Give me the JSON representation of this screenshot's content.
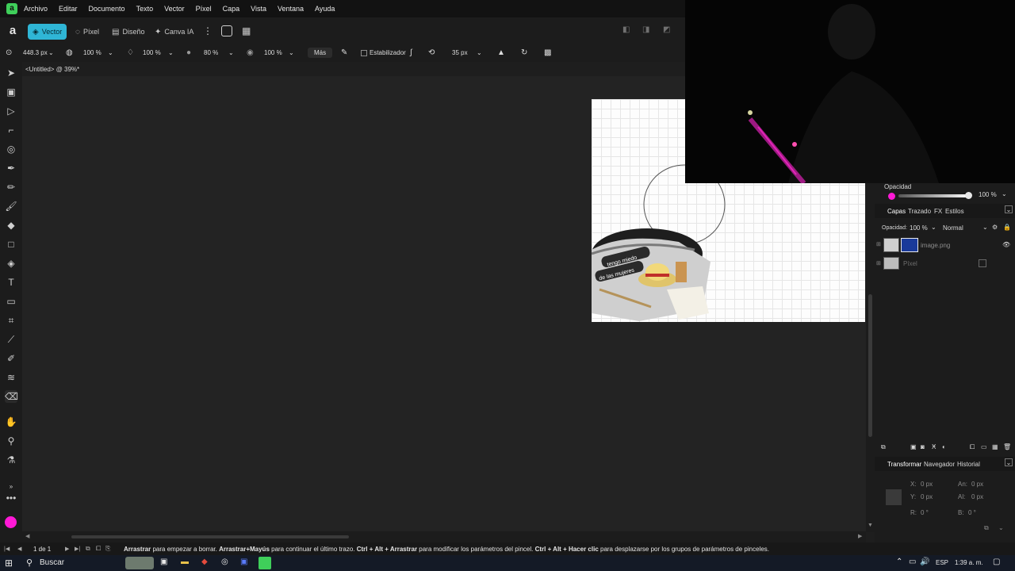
{
  "app": {
    "logo_letter": "a",
    "menu": [
      "Archivo",
      "Editar",
      "Documento",
      "Texto",
      "Vector",
      "Píxel",
      "Capa",
      "Vista",
      "Ventana",
      "Ayuda"
    ]
  },
  "toolbar": {
    "personas": [
      {
        "label": "Vector",
        "active": true
      },
      {
        "label": "Píxel",
        "active": false
      },
      {
        "label": "Diseño",
        "active": false
      },
      {
        "label": "Canva IA",
        "active": false
      }
    ]
  },
  "context": {
    "width": "448.3 px",
    "opacity1": "100 %",
    "flow": "100 %",
    "hardness": "80 %",
    "opacity2": "100 %",
    "more_label": "Más",
    "stabilizer_label": "Estabilizador",
    "size": "35 px"
  },
  "document": {
    "tab_title": "<Untitled> @ 39%*"
  },
  "artboard": {
    "sign_text_1": "tengo miedo",
    "sign_text_2": "de las mujeres"
  },
  "panel": {
    "opacity_label": "Opacidad",
    "opacity_value": "100 %",
    "tabs": [
      "Capas",
      "Trazado",
      "FX",
      "Estilos"
    ],
    "layer_opacity_label": "Opacidad:",
    "layer_opacity_value": "100 %",
    "blend_mode": "Normal",
    "layers": [
      {
        "name": "image.png"
      },
      {
        "name": "Píxel"
      }
    ],
    "bottom_tabs": [
      "Transformar",
      "Navegador",
      "Historial"
    ],
    "transform": {
      "x_label": "X:",
      "x_value": "0 px",
      "y_label": "Y:",
      "y_value": "0 px",
      "w_label": "An:",
      "w_value": "0 px",
      "h_label": "Al:",
      "h_value": "0 px",
      "r_label": "R:",
      "r_value": "0 °",
      "s_label": "B:",
      "s_value": "0 °"
    }
  },
  "status": {
    "page": "1 de 1",
    "hint_parts": [
      {
        "text": "Arrastrar",
        "bold": true
      },
      {
        "text": " para empezar a borrar. ",
        "bold": false
      },
      {
        "text": "Arrastrar+Mayús",
        "bold": true
      },
      {
        "text": " para continuar el último trazo. ",
        "bold": false
      },
      {
        "text": "Ctrl + Alt + Arrastrar",
        "bold": true
      },
      {
        "text": " para modificar los parámetros del pincel. ",
        "bold": false
      },
      {
        "text": "Ctrl + Alt + Hacer clic",
        "bold": true
      },
      {
        "text": " para desplazarse por los grupos de parámetros de pinceles.",
        "bold": false
      }
    ]
  },
  "taskbar": {
    "search_label": "Buscar",
    "lang": "ESP",
    "time": "1:39 a. m."
  },
  "colors": {
    "accent": "#2fb6d6",
    "primary_color_swatch": "#ff19d6",
    "app_logo": "#3fcf5a"
  }
}
